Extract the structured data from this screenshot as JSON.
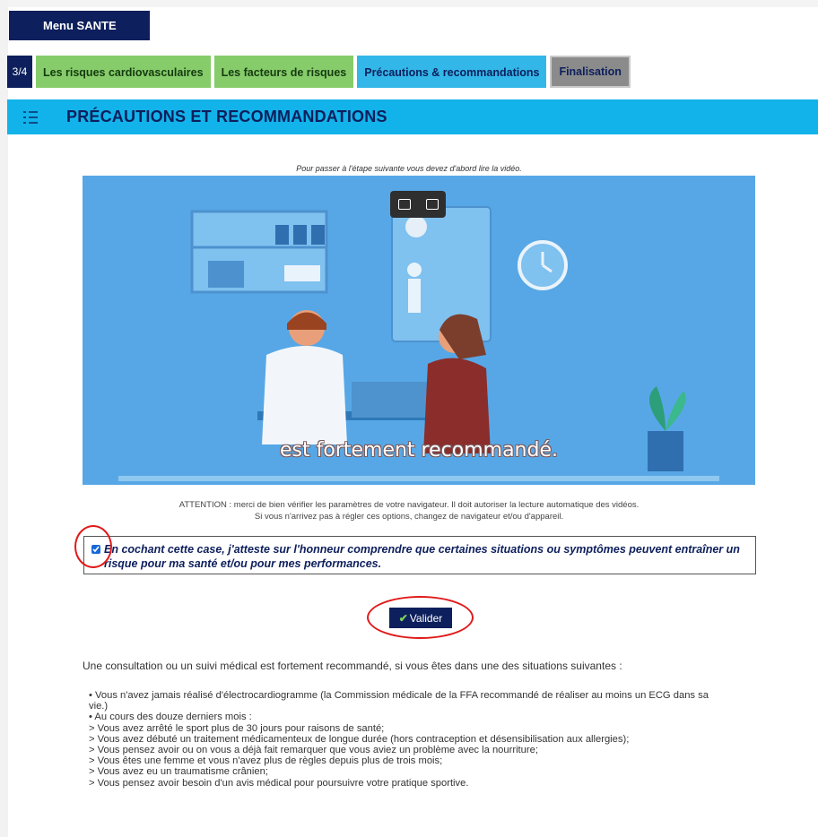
{
  "menu": {
    "label": "Menu SANTE"
  },
  "steps": {
    "counter": "3/4",
    "tabs": [
      {
        "label": "Les risques cardiovasculaires"
      },
      {
        "label": "Les facteurs de risques"
      },
      {
        "label": "Précautions & recommandations"
      },
      {
        "label": "Finalisation"
      }
    ]
  },
  "section": {
    "title": "PRÉCAUTIONS ET RECOMMANDATIONS",
    "icon": "list-icon"
  },
  "video": {
    "notice": "Pour passer à l'étape suivante vous devez d'abord lire la vidéo.",
    "subtitle": "est fortement recommandé.",
    "controls": [
      "picture-in-picture-icon",
      "cast-icon"
    ]
  },
  "attention": {
    "line1": "ATTENTION : merci de bien vérifier les paramètres de votre navigateur. Il doit autoriser la lecture automatique des vidéos.",
    "line2": "Si vous n'arrivez pas à régler ces options, changez de navigateur et/ou d'appareil."
  },
  "attest": {
    "checked": true,
    "text": "En cochant cette case, j'atteste sur l'honneur comprendre que certaines situations ou symptômes peuvent entraîner un risque pour ma santé et/ou pour mes performances."
  },
  "submit": {
    "label": "Valider",
    "icon": "check-icon"
  },
  "recommendation": {
    "intro": "Une consultation ou un suivi médical est fortement recommandé, si vous êtes dans une des situations suivantes :",
    "items": [
      "• Vous n'avez jamais réalisé d'électrocardiogramme (la Commission médicale de la FFA recommandé de réaliser au moins un ECG dans sa vie.)",
      "• Au cours des douze derniers mois :",
      "> Vous avez arrêté le sport plus de 30 jours pour raisons de santé;",
      "> Vous avez débuté un traitement médicamenteux de longue durée (hors contraception et désensibilisation aux allergies);",
      "> Vous pensez avoir ou on vous a déjà fait remarquer que vous aviez un problème avec la nourriture;",
      "> Vous êtes une femme et vous n'avez plus de règles depuis plus de trois mois;",
      "> Vous avez eu un traumatisme crânien;",
      "> Vous pensez avoir besoin d'un avis médical pour poursuivre votre pratique sportive."
    ]
  },
  "colors": {
    "navy": "#0d1f5c",
    "green_tab": "#86cc6a",
    "blue_band": "#12b3ea",
    "annotation_red": "#e01a1a"
  }
}
